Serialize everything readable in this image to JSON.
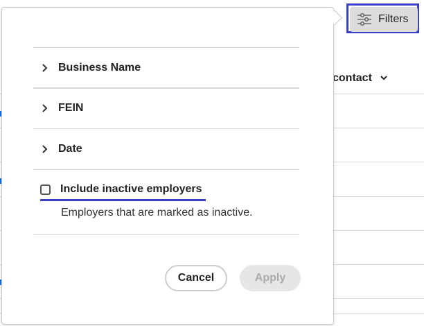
{
  "background_table": {
    "column_header": "contact"
  },
  "toolbar": {
    "filters_label": "Filters"
  },
  "filter_panel": {
    "sections": [
      {
        "label": "Business Name"
      },
      {
        "label": "FEIN"
      },
      {
        "label": "Date"
      }
    ],
    "include_inactive": {
      "label": "Include inactive employers",
      "description": "Employers that are marked as inactive.",
      "checked": false
    },
    "cancel_label": "Cancel",
    "apply_label": "Apply"
  },
  "colors": {
    "focus": "#3b3fc6",
    "link": "#1a6fd8"
  }
}
